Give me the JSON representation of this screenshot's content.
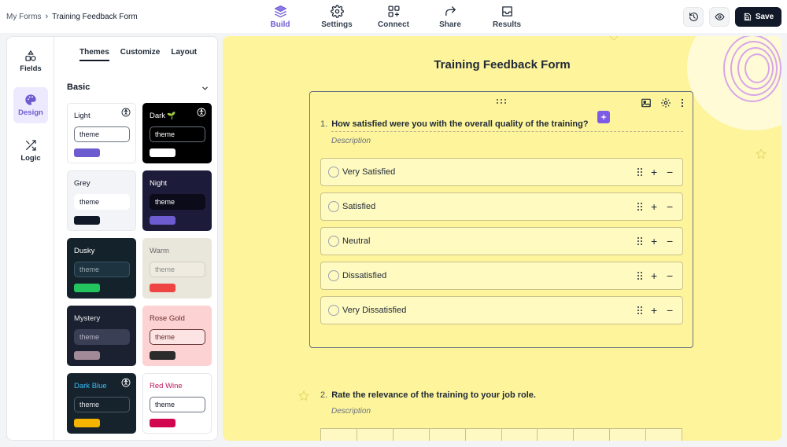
{
  "breadcrumb": {
    "root": "My Forms",
    "separator": "›",
    "current": "Training Feedback Form"
  },
  "nav": {
    "tabs": [
      {
        "label": "Build",
        "icon": "layers-icon",
        "active": true
      },
      {
        "label": "Settings",
        "icon": "gear-icon",
        "active": false
      },
      {
        "label": "Connect",
        "icon": "connect-icon",
        "active": false
      },
      {
        "label": "Share",
        "icon": "share-icon",
        "active": false
      },
      {
        "label": "Results",
        "icon": "inbox-icon",
        "active": false
      }
    ]
  },
  "toolbar": {
    "history_icon": "history-icon",
    "preview_icon": "eye-icon",
    "save_label": "Save"
  },
  "sidebar": {
    "rail": [
      {
        "label": "Fields",
        "icon": "shapes-icon",
        "active": false
      },
      {
        "label": "Design",
        "icon": "palette-icon",
        "active": true
      },
      {
        "label": "Logic",
        "icon": "shuffle-icon",
        "active": false
      }
    ],
    "subtabs": [
      {
        "label": "Themes",
        "active": true
      },
      {
        "label": "Customize",
        "active": false
      },
      {
        "label": "Layout",
        "active": false
      }
    ],
    "section_title": "Basic",
    "themes": [
      {
        "name": "Light",
        "input": "theme",
        "bg": "#ffffff",
        "text": "#111827",
        "input_bg": "#ffffff",
        "input_border": "#6b7280",
        "input_text": "#111827",
        "swatch": "#6d5bd0",
        "accessible": true,
        "emoji": ""
      },
      {
        "name": "Dark",
        "input": "theme",
        "bg": "#000000",
        "text": "#ffffff",
        "input_bg": "#000000",
        "input_border": "#6b7280",
        "input_text": "#ffffff",
        "swatch": "#ffffff",
        "accessible": true,
        "emoji": "🌱"
      },
      {
        "name": "Grey",
        "input": "theme",
        "bg": "#f3f4f8",
        "text": "#111827",
        "input_bg": "#ffffff",
        "input_border": "#ffffff",
        "input_text": "#111827",
        "swatch": "#111827",
        "accessible": false,
        "emoji": ""
      },
      {
        "name": "Night",
        "input": "theme",
        "bg": "#1c1b3a",
        "text": "#ffffff",
        "input_bg": "#0b0b1a",
        "input_border": "#0b0b1a",
        "input_text": "#ffffff",
        "swatch": "#6d5bd0",
        "accessible": false,
        "emoji": ""
      },
      {
        "name": "Dusky",
        "input": "theme",
        "bg": "#13222b",
        "text": "#ffffff",
        "input_bg": "#1d3440",
        "input_border": "#3a5563",
        "input_text": "#9aa8b0",
        "swatch": "#22c55e",
        "accessible": false,
        "emoji": ""
      },
      {
        "name": "Warm",
        "input": "theme",
        "bg": "#e9e6dc",
        "text": "#6b6b6b",
        "input_bg": "#efebe1",
        "input_border": "#d5cfc2",
        "input_text": "#8a8a8a",
        "swatch": "#ef4444",
        "accessible": false,
        "emoji": ""
      },
      {
        "name": "Mystery",
        "input": "theme",
        "bg": "#1c2131",
        "text": "#e5e7eb",
        "input_bg": "#3a3f55",
        "input_border": "#3a3f55",
        "input_text": "#b9b4c6",
        "swatch": "#a28a98",
        "accessible": false,
        "emoji": ""
      },
      {
        "name": "Rose Gold",
        "input": "theme",
        "bg": "#fcd2d2",
        "text": "#6b2d2d",
        "input_bg": "#fde4e4",
        "input_border": "#6b3a3a",
        "input_text": "#6b2d2d",
        "swatch": "#2b2b2b",
        "accessible": false,
        "emoji": ""
      },
      {
        "name": "Dark Blue",
        "input": "theme",
        "bg": "#16222c",
        "text": "#38bdf8",
        "input_bg": "#16222c",
        "input_border": "#4b5b66",
        "input_text": "#e5e7eb",
        "swatch": "#f4b400",
        "accessible": true,
        "emoji": ""
      },
      {
        "name": "Red Wine",
        "input": "theme",
        "bg": "#ffffff",
        "text": "#be185d",
        "input_bg": "#ffffff",
        "input_border": "#6b7280",
        "input_text": "#111827",
        "swatch": "#d1064f",
        "accessible": false,
        "emoji": ""
      }
    ]
  },
  "form": {
    "title": "Training Feedback Form",
    "q1": {
      "number": "1.",
      "text": "How satisfied were you with the overall quality of the training?",
      "description": "Description",
      "options": [
        "Very Satisfied",
        "Satisfied",
        "Neutral",
        "Dissatisfied",
        "Very Dissatisfied"
      ],
      "tools": [
        "image-icon",
        "gear-icon",
        "more-vertical-icon"
      ]
    },
    "q2": {
      "number": "2.",
      "text": "Rate the relevance of the training to your job role.",
      "description": "Description"
    }
  },
  "colors": {
    "accent": "#6d5bd0",
    "canvas_bg": "#fdf49b",
    "option_bg": "#fffac0",
    "save_bg": "#111827"
  }
}
